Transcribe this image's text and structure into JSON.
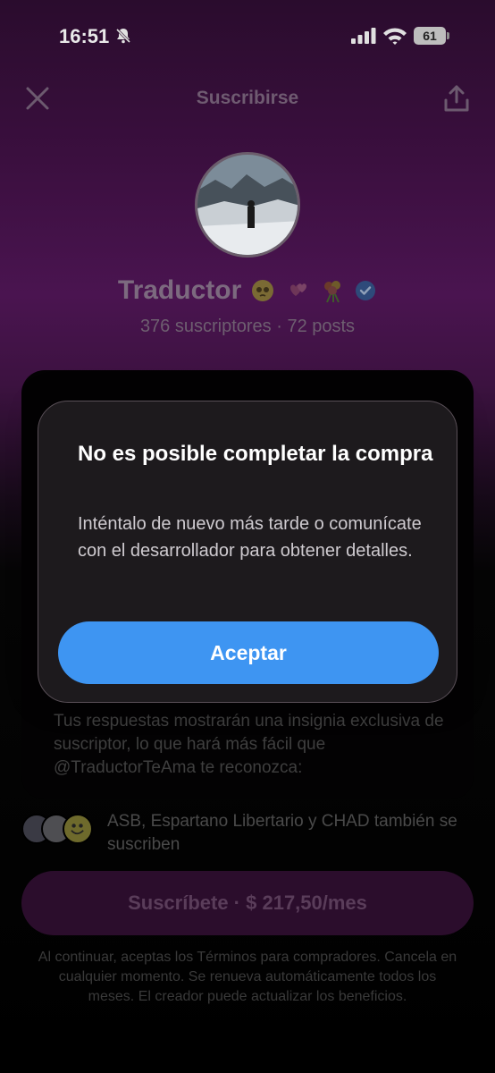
{
  "status_bar": {
    "time": "16:51",
    "battery": "61"
  },
  "header": {
    "title": "Suscribirse"
  },
  "profile": {
    "name": "Traductor",
    "stats": "376 suscriptores · 72 posts"
  },
  "benefit": {
    "text": "Tus respuestas mostrarán una insignia exclusiva de suscriptor, lo que hará más fácil que @TraductorTeAma te reconozca:"
  },
  "mutual": {
    "text": "ASB, Espartano Libertario y CHAD también se suscriben"
  },
  "subscribe": {
    "label": "Suscríbete · $ 217,50/mes"
  },
  "terms": {
    "text": "Al continuar, aceptas los Términos para compradores. Cancela en cualquier momento. Se renueva automáticamente todos los meses. El creador puede actualizar los beneficios."
  },
  "alert": {
    "title": "No es posible completar la compra",
    "message": "Inténtalo de nuevo más tarde o comunícate con el desarrollador para obtener detalles.",
    "accept_label": "Aceptar"
  },
  "colors": {
    "accent": "#3e95f2",
    "verified": "#1d9bf0",
    "backdrop": "#3b0f3f"
  }
}
